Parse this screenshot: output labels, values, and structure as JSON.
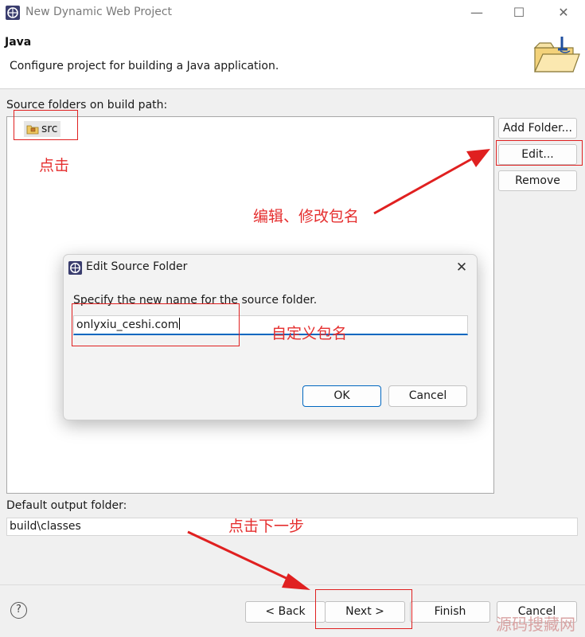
{
  "window": {
    "title": "New Dynamic Web Project",
    "controls": {
      "minimize": "—",
      "maximize": "☐",
      "close": "✕"
    }
  },
  "banner": {
    "title": "Java",
    "description": "Configure project for building a Java application."
  },
  "source_section": {
    "label": "Source folders on build path:",
    "items": [
      {
        "label": "src",
        "icon": "package-folder-icon"
      }
    ],
    "buttons": {
      "add_folder": "Add Folder...",
      "edit": "Edit...",
      "remove": "Remove"
    }
  },
  "output_section": {
    "label": "Default output folder:",
    "value": "build\\classes"
  },
  "footer": {
    "help": "?",
    "back": "< Back",
    "next": "Next >",
    "finish": "Finish",
    "cancel": "Cancel"
  },
  "dialog": {
    "title": "Edit Source Folder",
    "close": "✕",
    "prompt": "Specify the new name for the source folder.",
    "input_value": "onlyxiu_ceshi.com",
    "ok": "OK",
    "cancel": "Cancel"
  },
  "annotations": {
    "click": "点击",
    "edit_package": "编辑、修改包名",
    "custom_package": "自定义包名",
    "click_next": "点击下一步"
  },
  "watermark": "源码搜藏网",
  "colors": {
    "annotation": "#e02020",
    "focus": "#0067c0"
  }
}
